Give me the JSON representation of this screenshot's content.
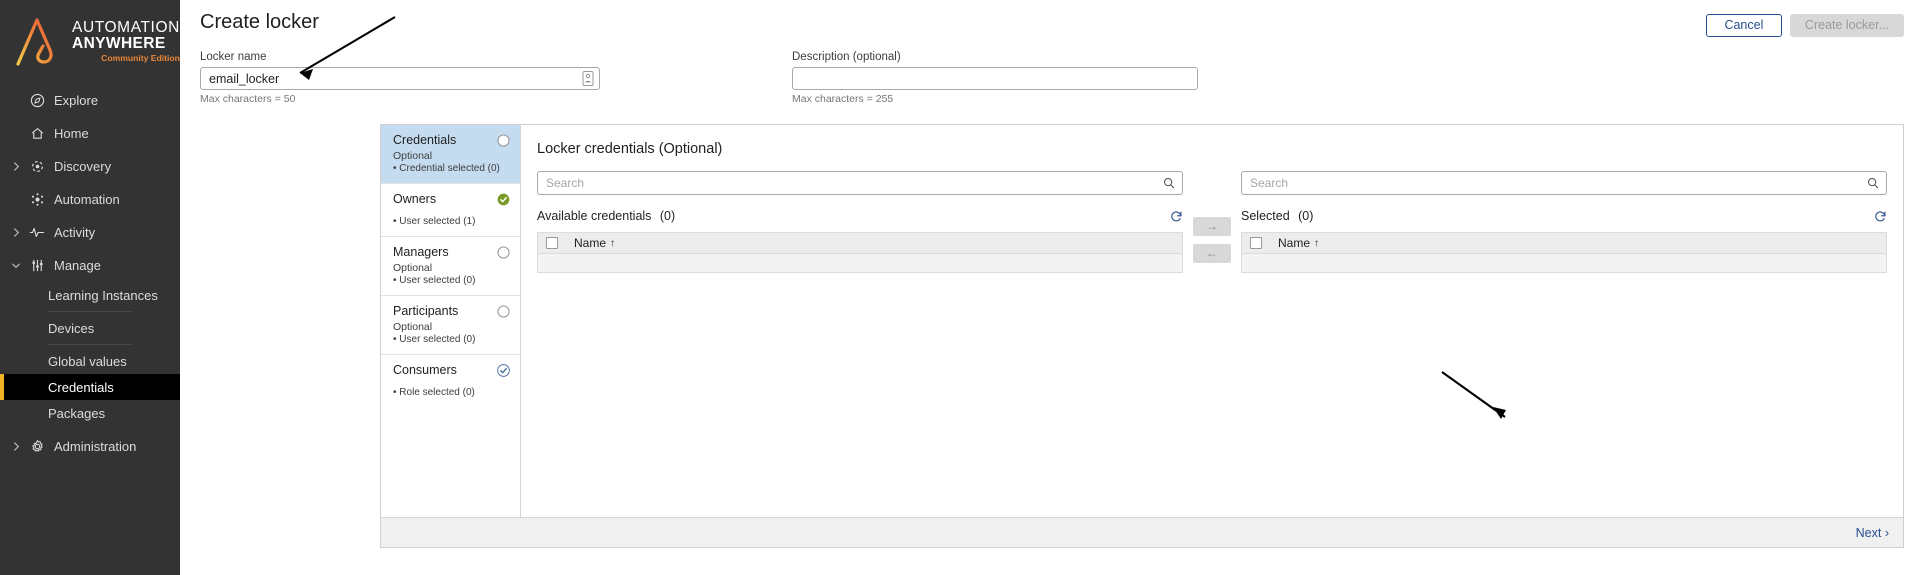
{
  "sidebar": {
    "logo": {
      "line1": "AUTOMATION",
      "line2": "ANYWHERE",
      "line3": "Community Edition"
    },
    "items": [
      {
        "label": "Explore",
        "icon": "compass-icon",
        "caret": false,
        "expanded": false
      },
      {
        "label": "Home",
        "icon": "home-icon",
        "caret": false,
        "expanded": false
      },
      {
        "label": "Discovery",
        "icon": "discovery-icon",
        "caret": true,
        "expanded": false
      },
      {
        "label": "Automation",
        "icon": "automation-icon",
        "caret": false,
        "expanded": false
      },
      {
        "label": "Activity",
        "icon": "activity-icon",
        "caret": true,
        "expanded": false
      },
      {
        "label": "Manage",
        "icon": "sliders-icon",
        "caret": true,
        "expanded": true
      }
    ],
    "sub_items": [
      {
        "label": "Learning Instances",
        "active": false,
        "divider_after": true
      },
      {
        "label": "Devices",
        "active": false,
        "divider_after": true
      },
      {
        "label": "Global values",
        "active": false,
        "divider_after": false
      },
      {
        "label": "Credentials",
        "active": true,
        "divider_after": false
      },
      {
        "label": "Packages",
        "active": false,
        "divider_after": false
      }
    ],
    "footer_item": {
      "label": "Administration",
      "icon": "gear-icon",
      "caret": true
    },
    "accent_color": "#f0b323",
    "active_bg": "#000000"
  },
  "header": {
    "title": "Create locker",
    "cancel_label": "Cancel",
    "create_label": "Create locker..."
  },
  "form": {
    "locker_name": {
      "label": "Locker name",
      "value": "email_locker",
      "placeholder": "",
      "helper": "Max characters = 50"
    },
    "description": {
      "label": "Description (optional)",
      "value": "",
      "placeholder": "",
      "helper": "Max characters = 255"
    }
  },
  "steps": [
    {
      "title": "Credentials",
      "optional": "Optional",
      "meta": "• Credential selected (0)",
      "state": "empty",
      "active": true
    },
    {
      "title": "Owners",
      "optional": "",
      "meta": "• User selected (1)",
      "state": "done",
      "active": false
    },
    {
      "title": "Managers",
      "optional": "Optional",
      "meta": "• User selected (0)",
      "state": "empty",
      "active": false
    },
    {
      "title": "Participants",
      "optional": "Optional",
      "meta": "• User selected (0)",
      "state": "empty",
      "active": false
    },
    {
      "title": "Consumers",
      "optional": "",
      "meta": "• Role selected (0)",
      "state": "checked",
      "active": false
    }
  ],
  "panel": {
    "title": "Locker credentials (Optional)",
    "available": {
      "search_placeholder": "Search",
      "search_value": "",
      "heading": "Available credentials",
      "count": "(0)",
      "column_name": "Name",
      "sort_arrow": "↑"
    },
    "selected": {
      "search_placeholder": "Search",
      "search_value": "",
      "heading": "Selected",
      "count": "(0)",
      "column_name": "Name",
      "sort_arrow": "↑"
    },
    "move_right_label": "→",
    "move_left_label": "←"
  },
  "footer": {
    "next_label": "Next ›"
  },
  "colors": {
    "accent_blue": "#2a4f8f",
    "step_active_bg": "#c5dcf0",
    "green_check": "#7a9a27",
    "sidebar_bg": "#333333"
  }
}
